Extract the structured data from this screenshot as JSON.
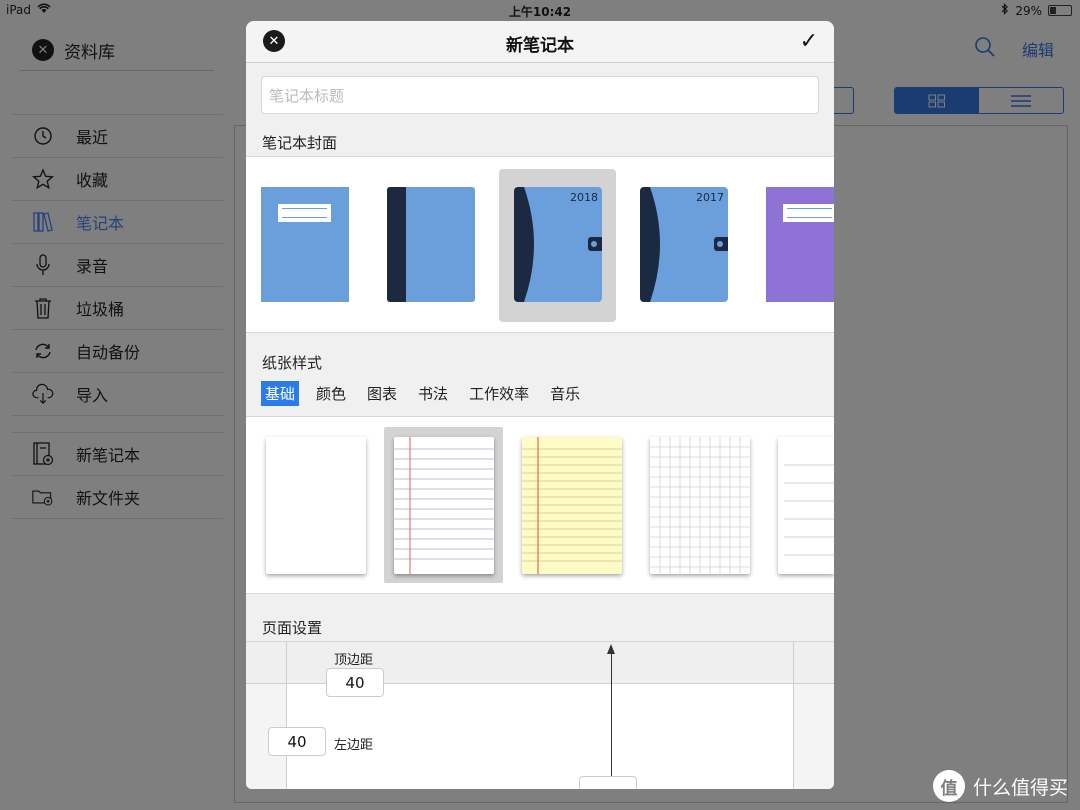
{
  "status_bar": {
    "device": "iPad",
    "time": "上午10:42",
    "battery": "29%"
  },
  "background": {
    "library_title": "资料库",
    "sidebar_items": [
      {
        "label": "最近",
        "icon": "clock-icon"
      },
      {
        "label": "收藏",
        "icon": "star-icon"
      },
      {
        "label": "笔记本",
        "icon": "notebooks-icon",
        "active": true
      },
      {
        "label": "录音",
        "icon": "microphone-icon"
      },
      {
        "label": "垃圾桶",
        "icon": "trash-icon"
      },
      {
        "label": "自动备份",
        "icon": "sync-icon"
      },
      {
        "label": "导入",
        "icon": "cloud-download-icon"
      }
    ],
    "sidebar_actions": [
      {
        "label": "新笔记本",
        "icon": "new-notebook-icon"
      },
      {
        "label": "新文件夹",
        "icon": "new-folder-icon"
      }
    ],
    "edit_label": "编辑",
    "accent": "#1b3c72"
  },
  "modal": {
    "title": "新笔记本",
    "title_placeholder": "笔记本标题",
    "cover_section": "笔记本封面",
    "covers": [
      {
        "style": "label",
        "color": "#6b9fdc",
        "year": ""
      },
      {
        "style": "spine",
        "color": "#6b9fdc",
        "year": ""
      },
      {
        "style": "planner",
        "color": "#6b9fdc",
        "year": "2018",
        "selected": true
      },
      {
        "style": "planner",
        "color": "#6b9fdc",
        "year": "2017"
      },
      {
        "style": "label",
        "color": "#8f72d6",
        "year": ""
      }
    ],
    "paper_section": "纸张样式",
    "paper_tabs": [
      {
        "label": "基础",
        "active": true
      },
      {
        "label": "颜色"
      },
      {
        "label": "图表"
      },
      {
        "label": "书法"
      },
      {
        "label": "工作效率"
      },
      {
        "label": "音乐"
      }
    ],
    "papers": [
      {
        "style": "blank"
      },
      {
        "style": "ruled-white",
        "selected": true
      },
      {
        "style": "ruled-yellow"
      },
      {
        "style": "grid"
      },
      {
        "style": "lines"
      }
    ],
    "page_setup_section": "页面设置",
    "top_margin_label": "顶边距",
    "top_margin_value": "40",
    "left_margin_label": "左边距",
    "left_margin_value": "40",
    "selection_highlight": "#2b7ce9"
  },
  "watermark": {
    "logo_text": "值",
    "text": "什么值得买"
  }
}
